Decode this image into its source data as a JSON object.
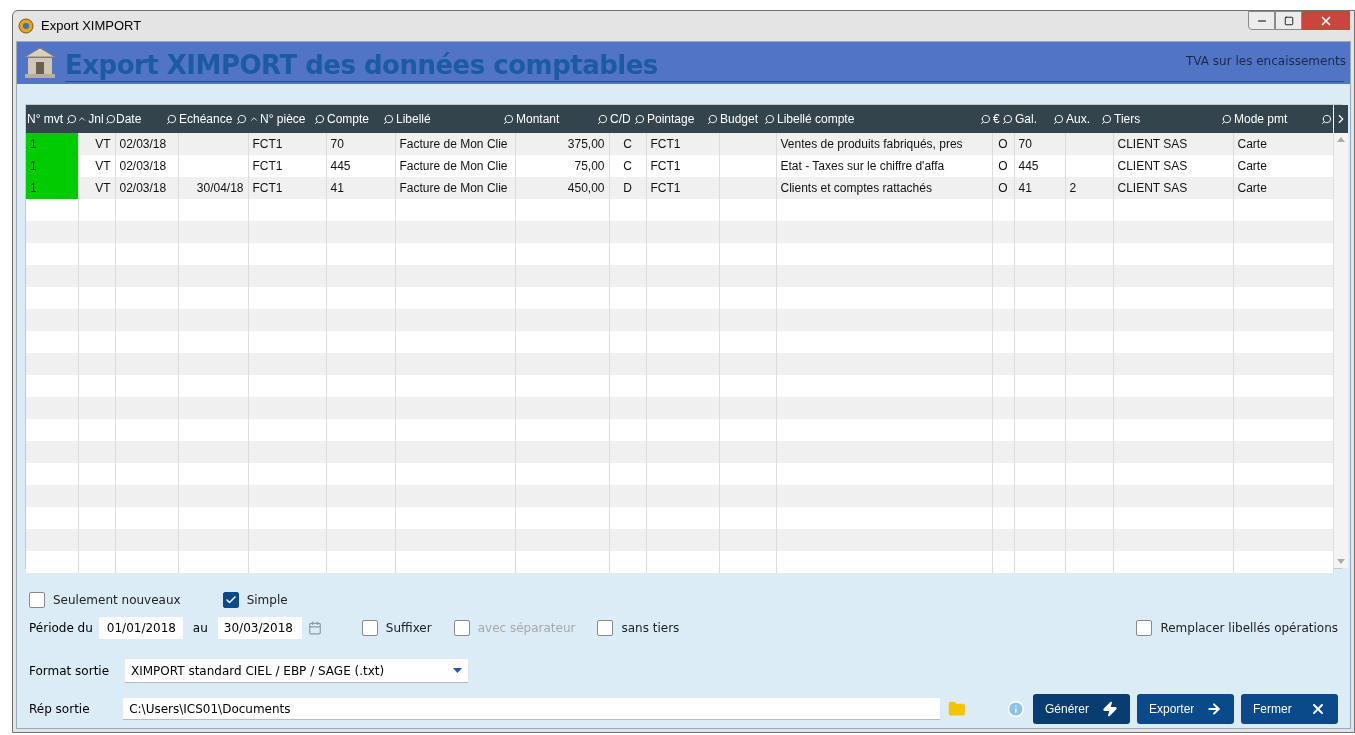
{
  "window": {
    "title": "Export XIMPORT"
  },
  "header": {
    "title": "Export XIMPORT des données comptables",
    "note": "TVA sur les encaissements"
  },
  "table": {
    "columns": [
      {
        "label": "N° mvt",
        "search": true,
        "sort": false
      },
      {
        "label": "Jnl",
        "search": true,
        "sort": true
      },
      {
        "label": "Date",
        "search": true,
        "sort": false
      },
      {
        "label": "Echéance",
        "search": true,
        "sort": false
      },
      {
        "label": "N° pièce",
        "search": true,
        "sort": true
      },
      {
        "label": "Compte",
        "search": true,
        "sort": false
      },
      {
        "label": "Libellé",
        "search": true,
        "sort": false
      },
      {
        "label": "Montant",
        "search": true,
        "sort": false
      },
      {
        "label": "C/D",
        "search": true,
        "sort": false
      },
      {
        "label": "Pointage",
        "search": true,
        "sort": false
      },
      {
        "label": "Budget",
        "search": true,
        "sort": false
      },
      {
        "label": "Libellé compte",
        "search": true,
        "sort": false
      },
      {
        "label": "€",
        "search": true,
        "sort": false
      },
      {
        "label": "Gal.",
        "search": true,
        "sort": false
      },
      {
        "label": "Aux.",
        "search": true,
        "sort": false
      },
      {
        "label": "Tiers",
        "search": true,
        "sort": false
      },
      {
        "label": "Mode pmt",
        "search": true,
        "sort": false
      }
    ],
    "rows": [
      {
        "color": "#00cc00",
        "cells": [
          "1",
          "VT",
          "02/03/18",
          "",
          "FCT1",
          "70",
          "Facture de Mon Clie",
          "375,00",
          "C",
          "FCT1",
          "",
          "Ventes de produits fabriqués, pres",
          "O",
          "70",
          "",
          "CLIENT SAS",
          "Carte"
        ]
      },
      {
        "color": "#00cc00",
        "cells": [
          "1",
          "VT",
          "02/03/18",
          "",
          "FCT1",
          "445",
          "Facture de Mon Clie",
          "75,00",
          "C",
          "FCT1",
          "",
          "Etat - Taxes sur le chiffre d'affa",
          "O",
          "445",
          "",
          "CLIENT SAS",
          "Carte"
        ]
      },
      {
        "color": "#00cc00",
        "cells": [
          "1",
          "VT",
          "02/03/18",
          "30/04/18",
          "FCT1",
          "41",
          "Facture de Mon Clie",
          "450,00",
          "D",
          "FCT1",
          "",
          "Clients et comptes rattachés",
          "O",
          "41",
          "2",
          "CLIENT SAS",
          "Carte"
        ]
      }
    ]
  },
  "options": {
    "checkboxes": [
      {
        "label": "Seulement nouveaux",
        "checked": false,
        "disabled": false
      },
      {
        "label": "Simple",
        "checked": true,
        "disabled": false
      }
    ],
    "period": {
      "label_from": "Période du",
      "from": "01/01/2018",
      "label_to": "au",
      "to": "30/03/2018"
    },
    "period_checkboxes": [
      {
        "label": "Suffixer",
        "checked": false,
        "disabled": false
      },
      {
        "label": "avec séparateur",
        "checked": false,
        "disabled": true
      },
      {
        "label": "sans tiers",
        "checked": false,
        "disabled": false
      }
    ],
    "replace_checkbox": {
      "label": "Remplacer libellés opérations",
      "checked": false,
      "disabled": false
    },
    "format": {
      "label": "Format sortie",
      "value": "XIMPORT standard CIEL / EBP / SAGE (.txt)"
    },
    "directory": {
      "label": "Rép sortie",
      "value": "C:\\Users\\ICS01\\Documents"
    }
  },
  "buttons": [
    {
      "label": "Générer",
      "kind": "generate"
    },
    {
      "label": "Exporter",
      "kind": "export"
    },
    {
      "label": "Fermer",
      "kind": "close"
    }
  ]
}
